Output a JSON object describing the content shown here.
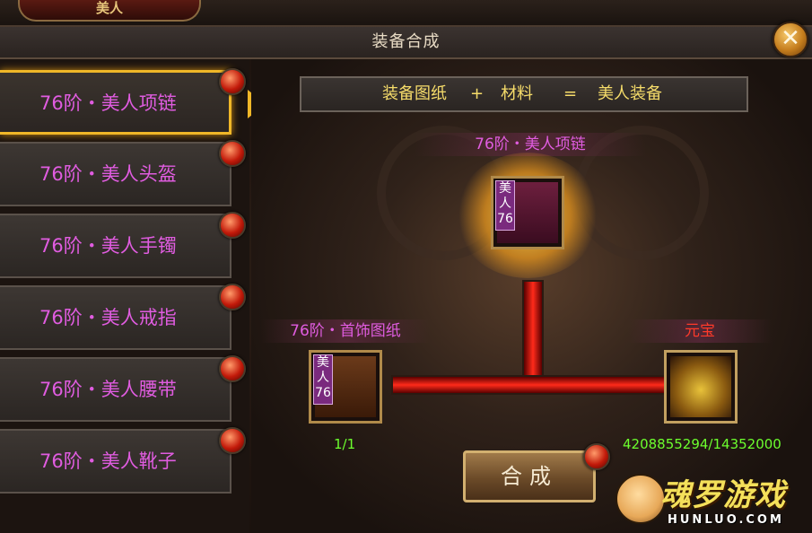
{
  "header": {
    "tab_label": "美人",
    "title": "装备合成",
    "close_label": "✕"
  },
  "sidebar": {
    "items": [
      {
        "label": "76阶・美人项链",
        "active": true
      },
      {
        "label": "76阶・美人头盔",
        "active": false
      },
      {
        "label": "76阶・美人手镯",
        "active": false
      },
      {
        "label": "76阶・美人戒指",
        "active": false
      },
      {
        "label": "76阶・美人腰带",
        "active": false
      },
      {
        "label": "76阶・美人靴子",
        "active": false
      }
    ]
  },
  "formula": {
    "part1": "装备图纸",
    "plus": "+",
    "part2": "材料",
    "equals": "=",
    "part3": "美人装备"
  },
  "result": {
    "label": "76阶・美人项链",
    "badge_text": "美人76",
    "icon": "necklace-icon"
  },
  "blueprint": {
    "label": "76阶・首饰图纸",
    "badge_text": "美人76",
    "icon": "blueprint-icon",
    "count": "1/1"
  },
  "material": {
    "label": "元宝",
    "icon": "gold-ingot-icon",
    "count": "4208855294/14352000"
  },
  "synth_button": {
    "label": "合成"
  },
  "watermark": {
    "name": "魂罗游戏",
    "url": "HUNLUO.COM"
  },
  "colors": {
    "accent_gold": "#f0b728",
    "item_pink": "#e05ce0",
    "count_green": "#6cff2e",
    "material_red": "#ff3a2a",
    "formula_yellow": "#f6dc6a"
  }
}
